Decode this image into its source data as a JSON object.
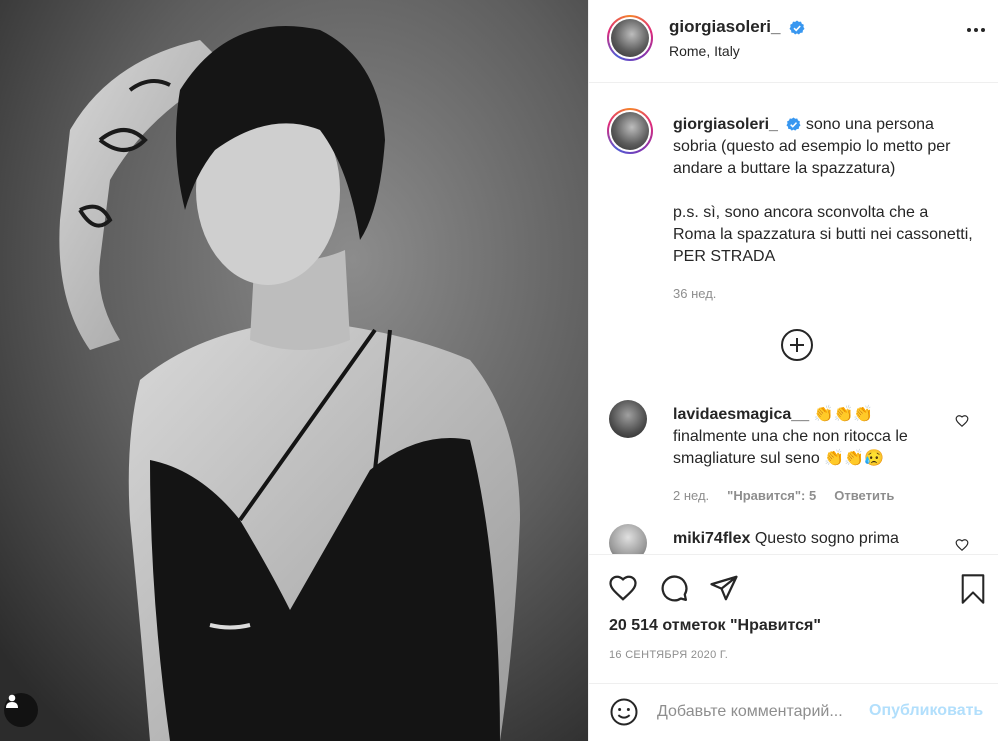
{
  "post": {
    "username": "giorgiasoleri_",
    "location": "Rome, Italy"
  },
  "caption": {
    "username": "giorgiasoleri_",
    "text": "sono una persona sobria (questo ad esempio lo metto per andare a buttare la spazzatura)",
    "ps": "p.s. sì, sono ancora sconvolta che a Roma la spazzatura si butti nei cassonetti, PER STRADA",
    "time": "36 нед."
  },
  "comments": [
    {
      "username": "lavidaesmagica__",
      "text_part1": "👏👏👏",
      "text_part2": "finalmente una che non ritocca le smagliature sul seno",
      "emoji_end": "👏👏😥",
      "time": "2 нед.",
      "likes": "\"Нравится\": 5",
      "reply": "Ответить"
    },
    {
      "username": "miki74flex",
      "text": "Questo sogno prima"
    }
  ],
  "stats": {
    "likes": "20 514 отметок \"Нравится\"",
    "date": "16 СЕНТЯБРЯ 2020 Г."
  },
  "add_comment": {
    "placeholder": "Добавьте комментарий...",
    "publish": "Опубликовать"
  },
  "icons": {
    "verified": "verified-badge-icon",
    "more": "more-options-icon",
    "like": "heart-icon",
    "comment": "comment-icon",
    "share": "paper-plane-icon",
    "save": "bookmark-icon",
    "emoji": "emoji-icon",
    "load_more": "plus-circle-icon",
    "user_tag": "user-tag-icon"
  },
  "colors": {
    "verified": "#3897f0",
    "publish": "#b2dffc",
    "secondary": "#8e8e8e"
  }
}
